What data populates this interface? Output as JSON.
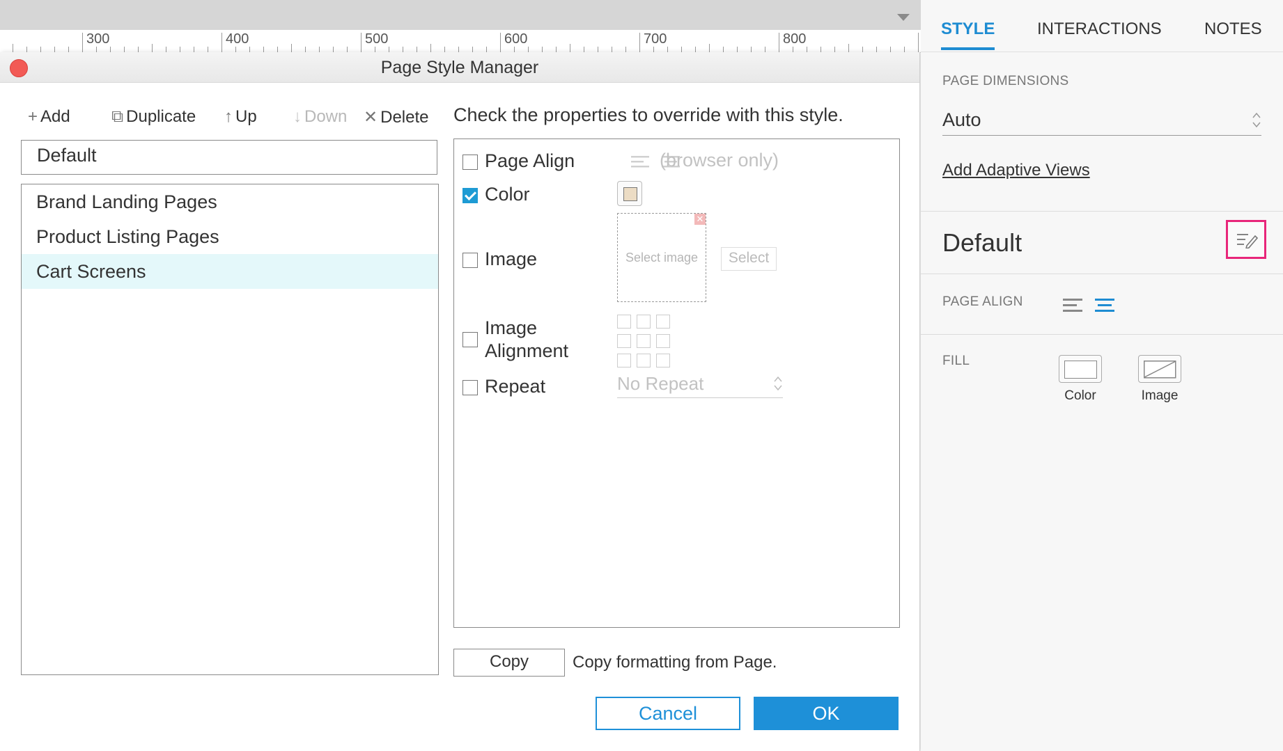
{
  "ruler": {
    "labels": [
      "300",
      "400",
      "500",
      "600",
      "700",
      "800"
    ]
  },
  "dialog": {
    "title": "Page Style Manager",
    "toolbar": {
      "add": "Add",
      "duplicate": "Duplicate",
      "up": "Up",
      "down": "Down",
      "delete": "Delete"
    },
    "default_style": "Default",
    "styles": [
      "Brand Landing Pages",
      "Product Listing Pages",
      "Cart Screens"
    ],
    "selected_style": "Cart Screens",
    "instruction": "Check the properties to override with this style.",
    "properties": {
      "page_align": {
        "label": "Page Align",
        "checked": false,
        "note": "(browser only)"
      },
      "color": {
        "label": "Color",
        "checked": true,
        "swatch": "#ecdcc4"
      },
      "image": {
        "label": "Image",
        "checked": false,
        "placeholder": "Select image",
        "select_button": "Select"
      },
      "image_alignment": {
        "label_line1": "Image",
        "label_line2": "Alignment",
        "checked": false
      },
      "repeat": {
        "label": "Repeat",
        "checked": false,
        "value": "No Repeat"
      }
    },
    "copy_button": "Copy",
    "copy_text": "Copy formatting from Page.",
    "cancel": "Cancel",
    "ok": "OK",
    "accent": "#1e90d8"
  },
  "panel": {
    "tabs": [
      "STYLE",
      "INTERACTIONS",
      "NOTES"
    ],
    "active_tab": "STYLE",
    "page_dimensions_label": "PAGE DIMENSIONS",
    "page_dimensions_value": "Auto",
    "adaptive_link": "Add Adaptive Views",
    "style_name": "Default",
    "page_align_label": "PAGE ALIGN",
    "fill_label": "FILL",
    "fill_color": "Color",
    "fill_image": "Image",
    "highlight_color": "#e8267a"
  }
}
